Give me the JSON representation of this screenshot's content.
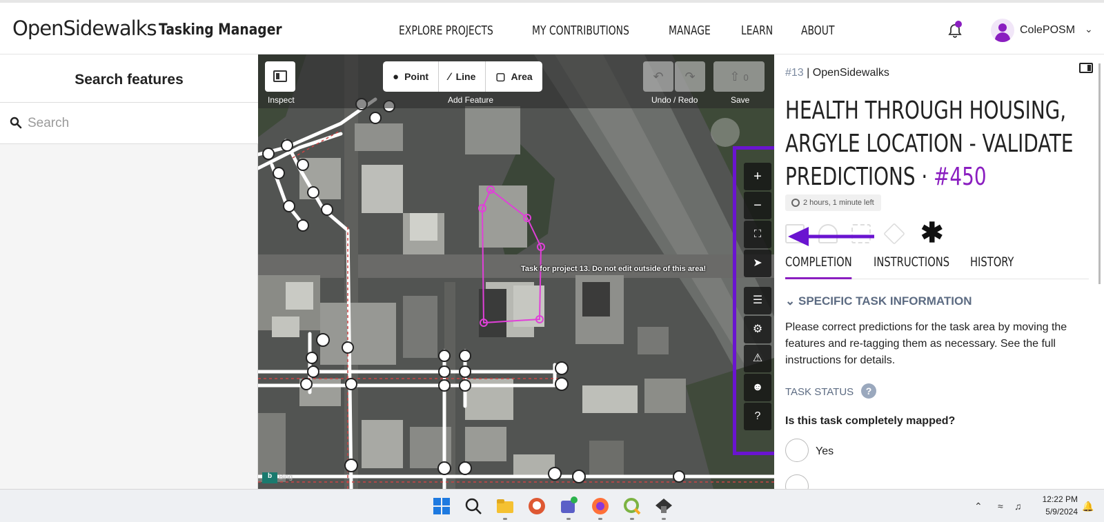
{
  "header": {
    "logo": "OpenSidewalks",
    "app_name": "Tasking Manager",
    "nav": [
      "EXPLORE PROJECTS",
      "MY CONTRIBUTIONS",
      "MANAGE",
      "LEARN",
      "ABOUT"
    ],
    "username": "ColePOSM"
  },
  "left_panel": {
    "title": "Search features",
    "search_placeholder": "Search"
  },
  "map": {
    "inspect_label": "Inspect",
    "add_feature_label": "Add Feature",
    "tools": [
      "Point",
      "Line",
      "Area"
    ],
    "undo_redo_label": "Undo / Redo",
    "save_label": "Save",
    "save_count": "0",
    "task_area_label": "Task for project 13. Do not edit outside of this area!",
    "attribution": "Bing",
    "controls": [
      "zoom-in",
      "zoom-out",
      "zoom-to-selection",
      "show-my-location",
      "background-layers",
      "map-data",
      "issues",
      "preferences",
      "help"
    ]
  },
  "right_panel": {
    "project_number": "#13",
    "project_org": "OpenSidewalks",
    "title": "HEALTH THROUGH HOUSING, ARGYLE LOCATION - VALIDATE PREDICTIONS",
    "task_number": "#450",
    "time_left": "2 hours, 1 minute left",
    "tabs": [
      "COMPLETION",
      "INSTRUCTIONS",
      "HISTORY"
    ],
    "section": "SPECIFIC TASK INFORMATION",
    "description": "Please correct predictions for the task area by moving the features and re-tagging them as necessary. See the full instructions for details.",
    "task_status_label": "TASK STATUS",
    "question": "Is this task completely mapped?",
    "option_yes": "Yes"
  },
  "taskbar": {
    "time": "12:22 PM",
    "date": "5/9/2024"
  },
  "colors": {
    "accent": "#8a1ec0",
    "highlight": "#6a14d0",
    "task_outline": "#e040d8"
  }
}
